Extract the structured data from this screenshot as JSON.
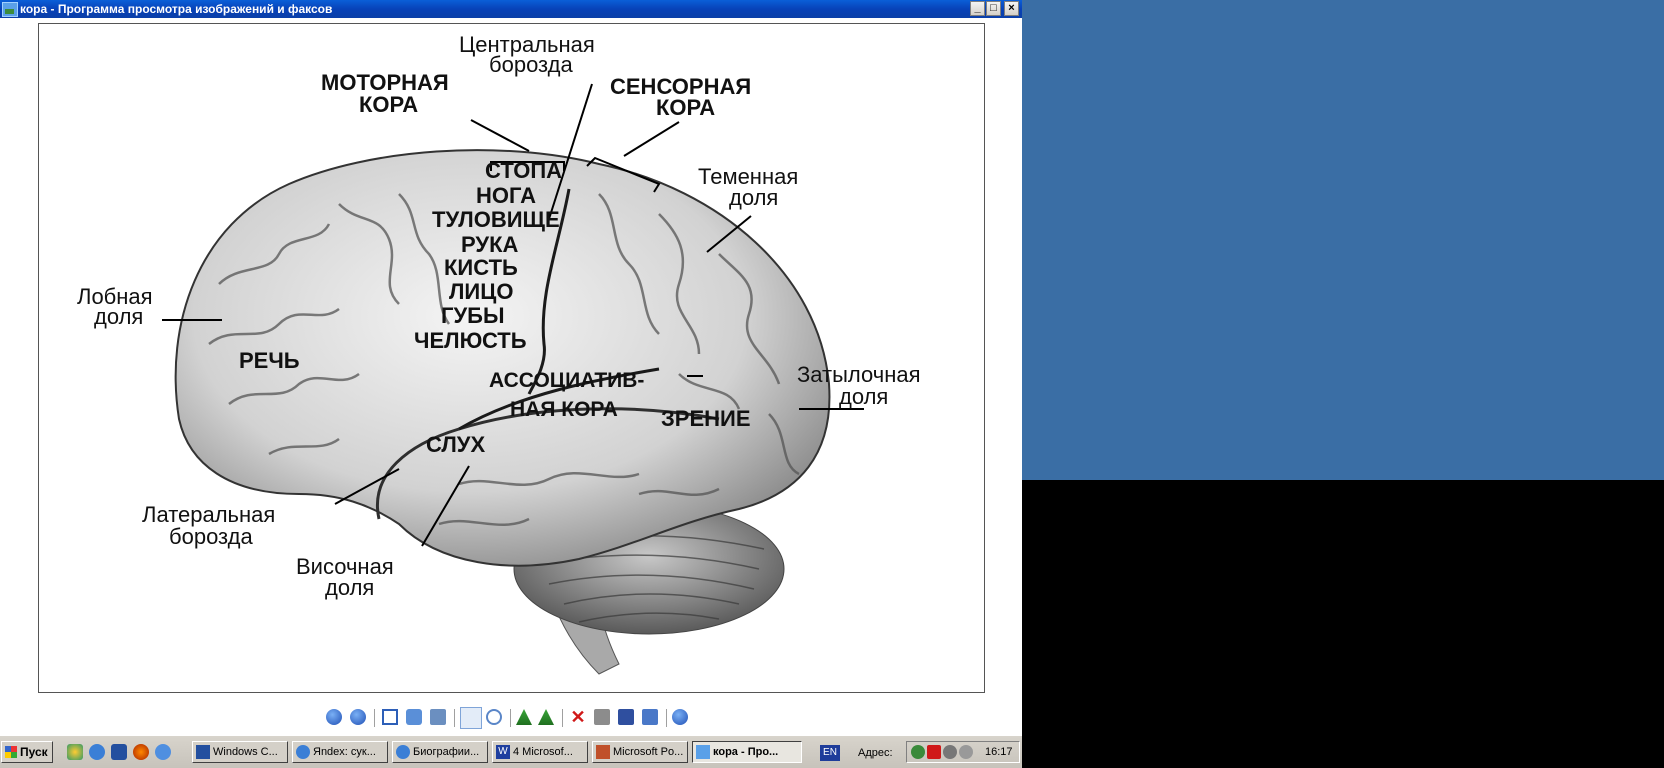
{
  "window": {
    "title": "кора - Программа просмотра изображений и факсов",
    "controls": {
      "minimize": "_",
      "maximize": "□",
      "close": "×"
    }
  },
  "image": {
    "labels": {
      "central_sulcus_1": "Центральная",
      "central_sulcus_2": "борозда",
      "motor_cortex_1": "МОТОРНАЯ",
      "motor_cortex_2": "КОРА",
      "sensory_cortex_1": "СЕНСОРНАЯ",
      "sensory_cortex_2": "КОРА",
      "parietal_1": "Теменная",
      "parietal_2": "доля",
      "frontal_1": "Лобная",
      "frontal_2": "доля",
      "foot": "СТОПА",
      "leg": "НОГА",
      "trunk": "ТУЛОВИЩЕ",
      "arm": "РУКА",
      "hand": "КИСТЬ",
      "face": "ЛИЦО",
      "lips": "ГУБЫ",
      "jaw": "ЧЕЛЮСТЬ",
      "speech": "РЕЧЬ",
      "assoc_1": "АССОЦИАТИВ-",
      "assoc_2": "НАЯ КОРА",
      "occipital_1": "Затылочная",
      "occipital_2": "доля",
      "vision": "ЗРЕНИЕ",
      "hearing": "СЛУХ",
      "lateral_1": "Латеральная",
      "lateral_2": "борозда",
      "temporal_1": "Височная",
      "temporal_2": "доля"
    }
  },
  "viewer_toolbar": {
    "icons": [
      "previous-icon",
      "next-icon",
      "best-fit-icon",
      "actual-size-icon",
      "slideshow-icon",
      "zoom-in-icon",
      "zoom-out-icon",
      "rotate-cw-icon",
      "rotate-ccw-icon",
      "delete-icon",
      "print-icon",
      "save-icon",
      "edit-icon",
      "help-icon"
    ]
  },
  "taskbar": {
    "start_label": "Пуск",
    "buttons": [
      {
        "label": "Windows C...",
        "icon": "windows-commander-icon"
      },
      {
        "label": "Яndex: сук...",
        "icon": "ie-icon"
      },
      {
        "label": "Биографии...",
        "icon": "ie-icon"
      },
      {
        "label": "4 Microsof...",
        "icon": "word-icon"
      },
      {
        "label": "Microsoft Po...",
        "icon": "powerpoint-icon"
      },
      {
        "label": "кора - Про...",
        "icon": "image-viewer-icon"
      }
    ],
    "language": "EN",
    "address_label": "Адрес:",
    "clock": "16:17"
  },
  "colors": {
    "desktop": "#3a6ea5",
    "titlebar": "#0a4fc8",
    "taskbar": "#d4d0c8"
  }
}
